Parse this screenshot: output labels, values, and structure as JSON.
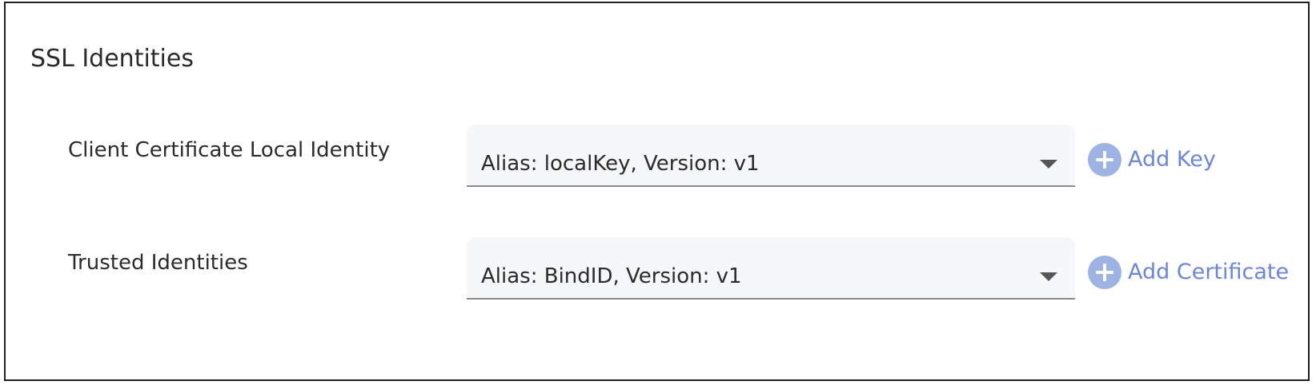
{
  "section": {
    "title": "SSL Identities"
  },
  "rows": [
    {
      "label": "Client Certificate Local Identity",
      "selected_value": "Alias: localKey, Version: v1",
      "add_label": "Add Key",
      "add_icon": "plus-circle-icon",
      "caret_icon": "caret-down-icon"
    },
    {
      "label": "Trusted Identities",
      "selected_value": "Alias: BindID, Version: v1",
      "add_label": "Add Certificate",
      "add_icon": "plus-circle-icon",
      "caret_icon": "caret-down-icon"
    }
  ],
  "colors": {
    "accent": "#6b86e0",
    "icon_fill": "#9db3e4",
    "field_background": "#f6f7f9",
    "text": "#2b2b2b",
    "border": "#1f1f1f"
  }
}
